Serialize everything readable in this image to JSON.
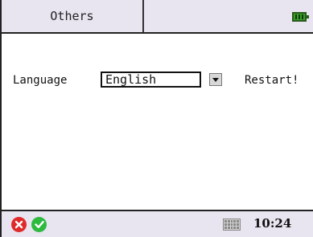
{
  "header": {
    "tab_title": "Others",
    "battery_icon": "battery-full-icon",
    "battery_color": "#3aa02a"
  },
  "settings": {
    "language_label": "Language",
    "language_value": "English",
    "restart_label": "Restart!"
  },
  "footer": {
    "cancel_icon": "close-circle-icon",
    "ok_icon": "check-circle-icon",
    "keyboard_icon": "keyboard-icon",
    "time": "10:24",
    "cancel_color": "#e02a2a",
    "ok_color": "#2dba3e"
  },
  "theme": {
    "bar_background": "#e8e4f0"
  }
}
